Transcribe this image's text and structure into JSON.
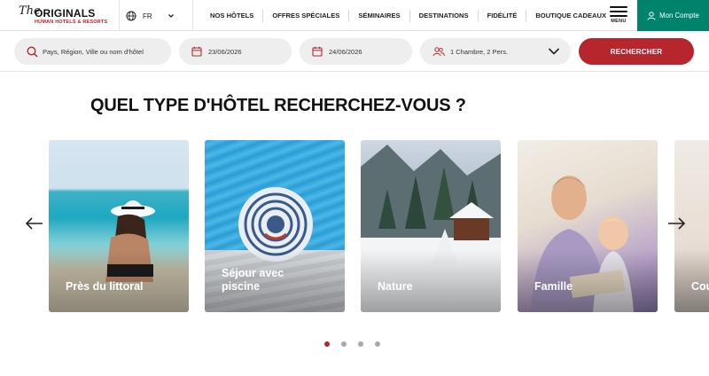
{
  "header": {
    "logo": {
      "the": "The",
      "brand": "ORIGINALS",
      "tagline": "HUMAN HOTELS & RESORTS"
    },
    "language": "FR",
    "nav": [
      "NOS HÔTELS",
      "OFFRES SPÉCIALES",
      "SÉMINAIRES",
      "DESTINATIONS",
      "FIDÉLITÉ",
      "BOUTIQUE CADEAUX"
    ],
    "menu_label": "MENU",
    "account_label": "Mon Compte"
  },
  "search": {
    "destination_placeholder": "Pays, Région, Ville ou nom d'hôtel",
    "check_in": "23/06/2026",
    "check_out": "24/06/2026",
    "rooms": "1 Chambre, 2 Pers.",
    "button_label": "RECHERCHER"
  },
  "section": {
    "title": "QUEL TYPE D'HÔTEL RECHERCHEZ-VOUS ?",
    "cards": [
      {
        "label": "Près du littoral"
      },
      {
        "label": "Séjour avec piscine"
      },
      {
        "label": "Nature"
      },
      {
        "label": "Famille"
      },
      {
        "label": "Cou"
      }
    ],
    "pagination": {
      "total": 4,
      "active": 1
    }
  },
  "colors": {
    "accent_red": "#b7262d",
    "account_green": "#00836d",
    "field_bg": "#eeeeee"
  },
  "icons": [
    "globe-icon",
    "chevron-down-icon",
    "menu-icon",
    "user-icon",
    "search-icon",
    "calendar-icon",
    "users-icon",
    "arrow-left-icon",
    "arrow-right-icon"
  ]
}
